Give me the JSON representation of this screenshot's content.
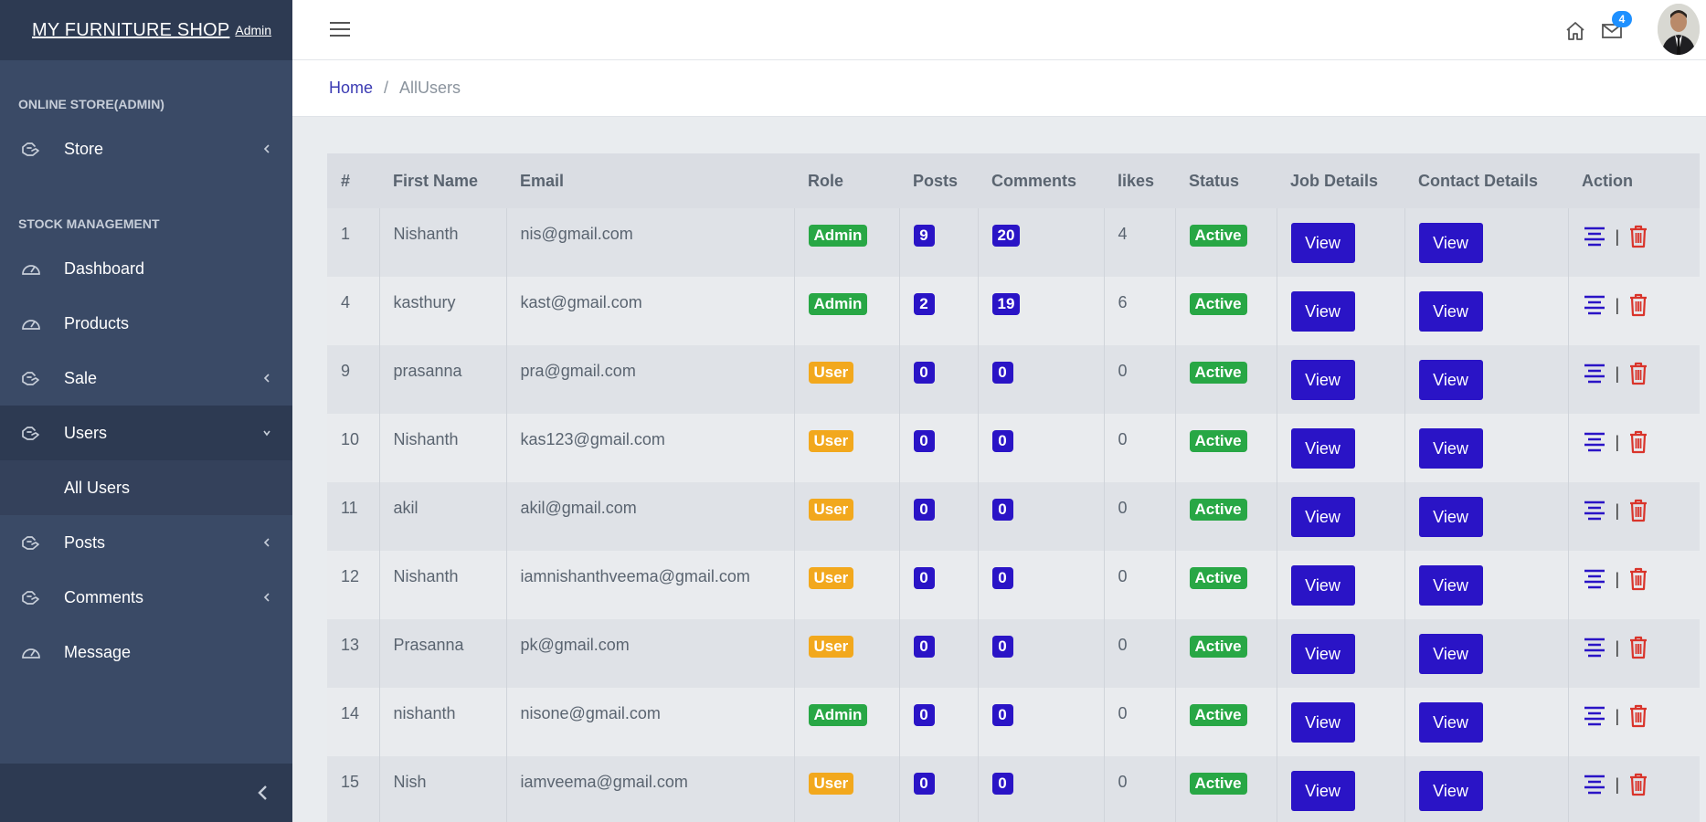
{
  "brand": {
    "name": "MY FURNITURE SHOP",
    "sub": "Admin"
  },
  "sidebar": {
    "section1": "ONLINE STORE(ADMIN)",
    "section2": "STOCK MANAGEMENT",
    "items": [
      {
        "label": "Store"
      },
      {
        "label": "Dashboard"
      },
      {
        "label": "Products"
      },
      {
        "label": "Sale"
      },
      {
        "label": "Users"
      },
      {
        "label": "All Users"
      },
      {
        "label": "Posts"
      },
      {
        "label": "Comments"
      },
      {
        "label": "Message"
      }
    ]
  },
  "header": {
    "mail_count": "4"
  },
  "breadcrumb": {
    "home": "Home",
    "sep": "/",
    "current": "AllUsers"
  },
  "table": {
    "headers": [
      "#",
      "First Name",
      "Email",
      "Role",
      "Posts",
      "Comments",
      "likes",
      "Status",
      "Job Details",
      "Contact Details",
      "Action"
    ],
    "view_label": "View",
    "pipe": "|",
    "rows": [
      {
        "id": "1",
        "name": "Nishanth",
        "email": "nis@gmail.com",
        "role": "Admin",
        "posts": "9",
        "comments": "20",
        "likes": "4",
        "status": "Active"
      },
      {
        "id": "4",
        "name": "kasthury",
        "email": "kast@gmail.com",
        "role": "Admin",
        "posts": "2",
        "comments": "19",
        "likes": "6",
        "status": "Active"
      },
      {
        "id": "9",
        "name": "prasanna",
        "email": "pra@gmail.com",
        "role": "User",
        "posts": "0",
        "comments": "0",
        "likes": "0",
        "status": "Active"
      },
      {
        "id": "10",
        "name": "Nishanth",
        "email": "kas123@gmail.com",
        "role": "User",
        "posts": "0",
        "comments": "0",
        "likes": "0",
        "status": "Active"
      },
      {
        "id": "11",
        "name": "akil",
        "email": "akil@gmail.com",
        "role": "User",
        "posts": "0",
        "comments": "0",
        "likes": "0",
        "status": "Active"
      },
      {
        "id": "12",
        "name": "Nishanth",
        "email": "iamnishanthveema@gmail.com",
        "role": "User",
        "posts": "0",
        "comments": "0",
        "likes": "0",
        "status": "Active"
      },
      {
        "id": "13",
        "name": "Prasanna",
        "email": "pk@gmail.com",
        "role": "User",
        "posts": "0",
        "comments": "0",
        "likes": "0",
        "status": "Active"
      },
      {
        "id": "14",
        "name": "nishanth",
        "email": "nisone@gmail.com",
        "role": "Admin",
        "posts": "0",
        "comments": "0",
        "likes": "0",
        "status": "Active"
      },
      {
        "id": "15",
        "name": "Nish",
        "email": "iamveema@gmail.com",
        "role": "User",
        "posts": "0",
        "comments": "0",
        "likes": "0",
        "status": "Active"
      }
    ]
  },
  "colors": {
    "sidebar": "#3a4a66",
    "primary": "#2a14c6",
    "admin": "#28a745",
    "user": "#f2a81d",
    "danger": "#d9342b"
  },
  "icons": {
    "nav": "hand-icon",
    "dashboard": "gauge-icon",
    "home": "home-icon",
    "mail": "mail-icon",
    "edit": "align-center-icon",
    "delete": "trash-icon"
  }
}
